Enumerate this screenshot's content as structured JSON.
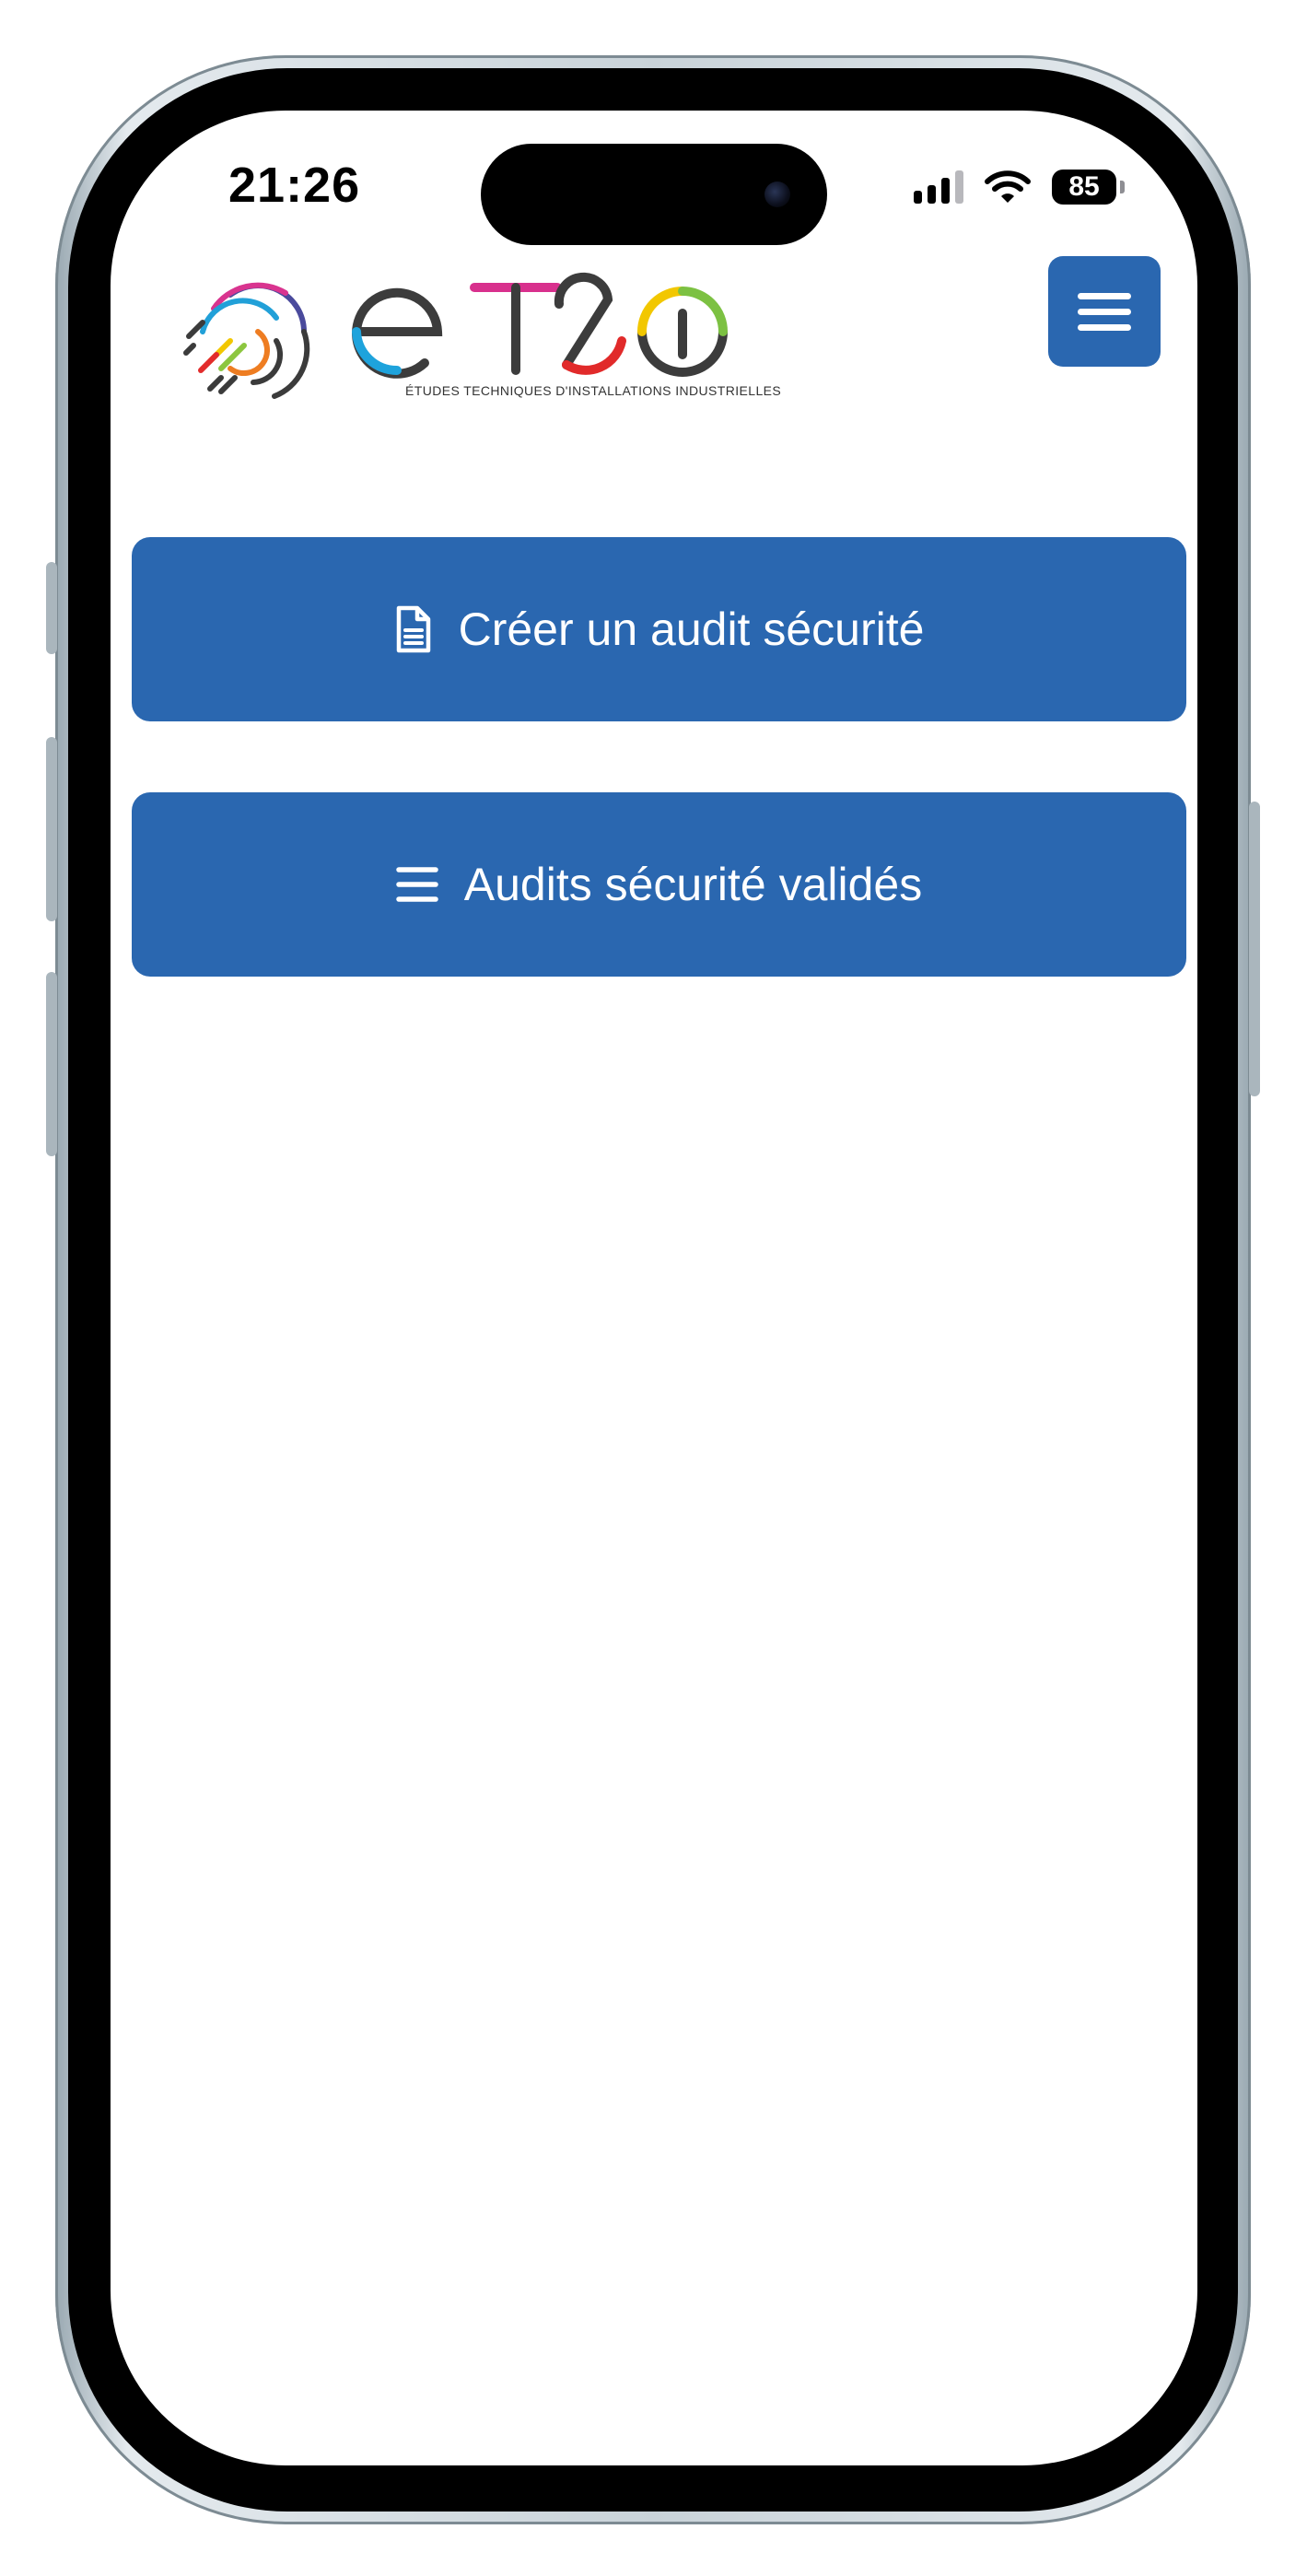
{
  "status_bar": {
    "time": "21:26",
    "battery": "85",
    "icons": [
      "signal-icon",
      "wifi-icon",
      "battery-icon"
    ]
  },
  "header": {
    "logo_text": "etzi",
    "tagline": "ÉTUDES TECHNIQUES D'INSTALLATIONS INDUSTRIELLES",
    "menu_icon": "hamburger-icon"
  },
  "actions": [
    {
      "label": "Créer un audit sécurité",
      "icon": "document-icon"
    },
    {
      "label": "Audits sécurité validés",
      "icon": "list-icon"
    }
  ],
  "colors": {
    "primary": "#2a67b0",
    "button_text": "#ffffff",
    "background": "#ffffff"
  }
}
